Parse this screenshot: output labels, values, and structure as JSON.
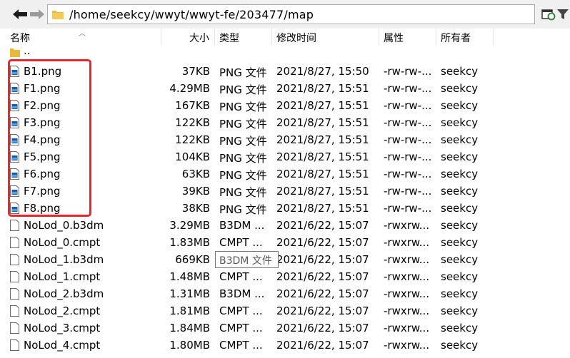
{
  "toolbar": {
    "path": "/home/seekcy/wwyt/wwyt-fe/203477/map",
    "icons": [
      "back-arrow-icon",
      "forward-arrow-icon",
      "folder-icon",
      "refresh-icon",
      "filter-icon"
    ]
  },
  "columns": {
    "name": "名称",
    "size": "大小",
    "type": "类型",
    "modified": "修改时间",
    "attributes": "属性",
    "owner": "所有者"
  },
  "parent_dir": "..",
  "files": [
    {
      "name": "B1.png",
      "size": "37KB",
      "type": "PNG 文件",
      "modified": "2021/8/27, 15:50",
      "attributes": "-rw-rw-...",
      "owner": "seekcy",
      "icon": "png-image-icon"
    },
    {
      "name": "F1.png",
      "size": "4.29MB",
      "type": "PNG 文件",
      "modified": "2021/8/27, 15:51",
      "attributes": "-rw-rw-...",
      "owner": "seekcy",
      "icon": "png-image-icon"
    },
    {
      "name": "F2.png",
      "size": "167KB",
      "type": "PNG 文件",
      "modified": "2021/8/27, 15:51",
      "attributes": "-rw-rw-...",
      "owner": "seekcy",
      "icon": "png-image-icon"
    },
    {
      "name": "F3.png",
      "size": "122KB",
      "type": "PNG 文件",
      "modified": "2021/8/27, 15:51",
      "attributes": "-rw-rw-...",
      "owner": "seekcy",
      "icon": "png-image-icon"
    },
    {
      "name": "F4.png",
      "size": "122KB",
      "type": "PNG 文件",
      "modified": "2021/8/27, 15:51",
      "attributes": "-rw-rw-...",
      "owner": "seekcy",
      "icon": "png-image-icon"
    },
    {
      "name": "F5.png",
      "size": "104KB",
      "type": "PNG 文件",
      "modified": "2021/8/27, 15:51",
      "attributes": "-rw-rw-...",
      "owner": "seekcy",
      "icon": "png-image-icon"
    },
    {
      "name": "F6.png",
      "size": "63KB",
      "type": "PNG 文件",
      "modified": "2021/8/27, 15:51",
      "attributes": "-rw-rw-...",
      "owner": "seekcy",
      "icon": "png-image-icon"
    },
    {
      "name": "F7.png",
      "size": "39KB",
      "type": "PNG 文件",
      "modified": "2021/8/27, 15:51",
      "attributes": "-rw-rw-...",
      "owner": "seekcy",
      "icon": "png-image-icon"
    },
    {
      "name": "F8.png",
      "size": "38KB",
      "type": "PNG 文件",
      "modified": "2021/8/27, 15:51",
      "attributes": "-rw-rw-...",
      "owner": "seekcy",
      "icon": "png-image-icon"
    },
    {
      "name": "NoLod_0.b3dm",
      "size": "3.29MB",
      "type": "B3DM ...",
      "modified": "2021/6/22, 15:07",
      "attributes": "-rwxrw...",
      "owner": "seekcy",
      "icon": "blank-file-icon"
    },
    {
      "name": "NoLod_0.cmpt",
      "size": "1.83MB",
      "type": "CMPT ...",
      "modified": "2021/6/22, 15:07",
      "attributes": "-rwxrw...",
      "owner": "seekcy",
      "icon": "blank-file-icon"
    },
    {
      "name": "NoLod_1.b3dm",
      "size": "669KB",
      "type": "",
      "modified": "2021/6/22, 15:07",
      "attributes": "-rwxrw...",
      "owner": "seekcy",
      "icon": "blank-file-icon"
    },
    {
      "name": "NoLod_1.cmpt",
      "size": "1.48MB",
      "type": "CMPT ...",
      "modified": "2021/6/22, 15:07",
      "attributes": "-rwxrw...",
      "owner": "seekcy",
      "icon": "blank-file-icon"
    },
    {
      "name": "NoLod_2.b3dm",
      "size": "1.31MB",
      "type": "B3DM ...",
      "modified": "2021/6/22, 15:07",
      "attributes": "-rwxrw...",
      "owner": "seekcy",
      "icon": "blank-file-icon"
    },
    {
      "name": "NoLod_2.cmpt",
      "size": "1.81MB",
      "type": "CMPT ...",
      "modified": "2021/6/22, 15:07",
      "attributes": "-rwxrw...",
      "owner": "seekcy",
      "icon": "blank-file-icon"
    },
    {
      "name": "NoLod_3.cmpt",
      "size": "1.84MB",
      "type": "CMPT ...",
      "modified": "2021/6/22, 15:07",
      "attributes": "-rwxrw...",
      "owner": "seekcy",
      "icon": "blank-file-icon"
    },
    {
      "name": "NoLod_4.cmpt",
      "size": "1.80MB",
      "type": "CMPT ...",
      "modified": "2021/6/22, 15:07",
      "attributes": "-rwxrw...",
      "owner": "seekcy",
      "icon": "blank-file-icon"
    }
  ],
  "tooltip": {
    "text": "B3DM 文件"
  },
  "highlight": {
    "color": "#e8262c",
    "note_target": "png files B1–F8"
  }
}
